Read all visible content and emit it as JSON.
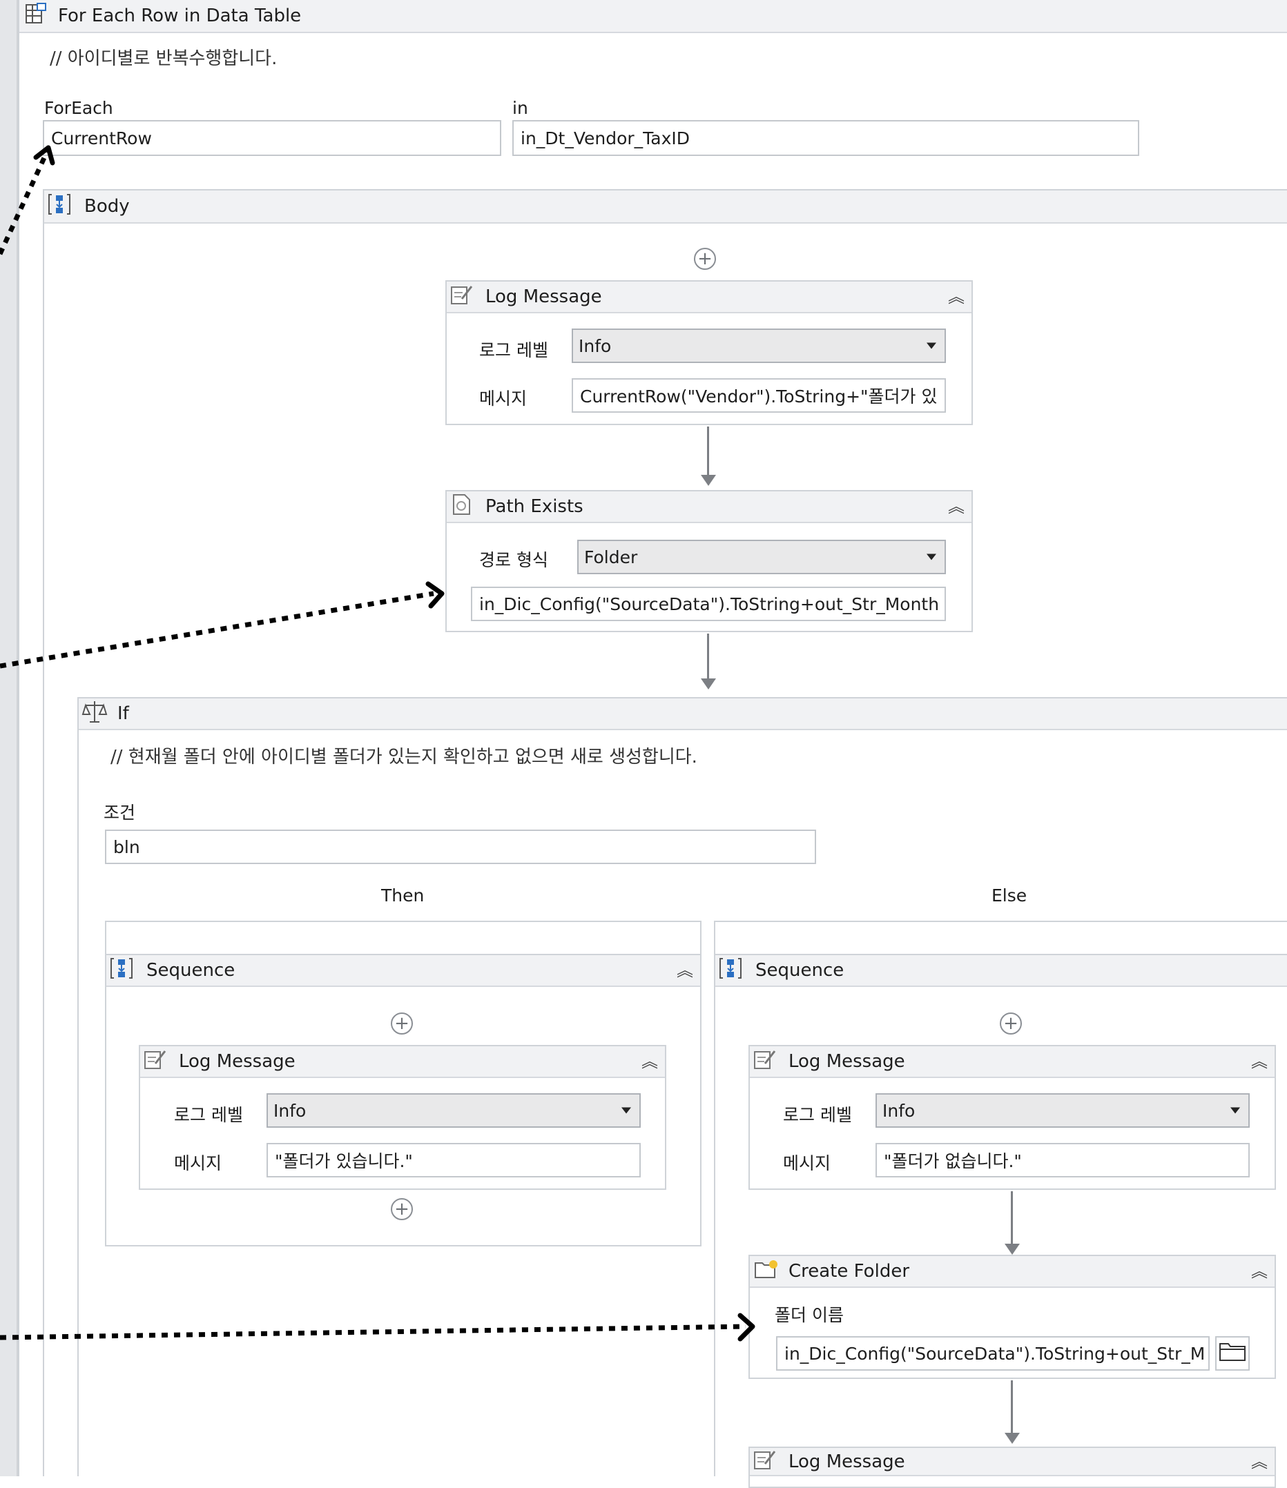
{
  "foreach_activity": {
    "title": "For Each Row in Data Table",
    "comment": "// 아이디별로 반복수행합니다.",
    "foreach_label": "ForEach",
    "foreach_value": "CurrentRow",
    "in_label": "in",
    "in_value": "in_Dt_Vendor_TaxID"
  },
  "body": {
    "title": "Body"
  },
  "log_message_1": {
    "title": "Log Message",
    "level_label": "로그 레벨",
    "level_value": "Info",
    "message_label": "메시지",
    "message_value": "CurrentRow(\"Vendor\").ToString+\"폴더가 있"
  },
  "path_exists": {
    "title": "Path Exists",
    "path_type_label": "경로 형식",
    "path_type_value": "Folder",
    "path_value": "in_Dic_Config(\"SourceData\").ToString+out_Str_Month"
  },
  "if_activity": {
    "title": "If",
    "comment": "// 현재월 폴더 안에 아이디별 폴더가 있는지 확인하고 없으면 새로 생성합니다.",
    "condition_label": "조건",
    "condition_value": "bln",
    "then_label": "Then",
    "else_label": "Else"
  },
  "then_sequence": {
    "title": "Sequence",
    "log_message": {
      "title": "Log Message",
      "level_label": "로그 레벨",
      "level_value": "Info",
      "message_label": "메시지",
      "message_value": "\"폴더가 있습니다.\""
    }
  },
  "else_sequence": {
    "title": "Sequence",
    "log_message": {
      "title": "Log Message",
      "level_label": "로그 레벨",
      "level_value": "Info",
      "message_label": "메시지",
      "message_value": "\"폴더가 없습니다.\""
    },
    "create_folder": {
      "title": "Create Folder",
      "folder_name_label": "폴더 이름",
      "folder_name_value": "in_Dic_Config(\"SourceData\").ToString+out_Str_M"
    },
    "log_message_2": {
      "title": "Log Message"
    }
  },
  "icons": {
    "foreach": "data-table-icon",
    "sequence": "sequence-icon",
    "log": "log-message-icon",
    "path": "path-exists-icon",
    "if": "if-icon",
    "folder": "create-folder-icon",
    "browse": "browse-folder-icon",
    "collapse": "double-chevron-up-icon"
  },
  "colors": {
    "header_bg": "#f1f2f4",
    "border": "#cfd3d8",
    "icon_blue": "#2b6fc2",
    "folder_yellow": "#f2c230"
  }
}
